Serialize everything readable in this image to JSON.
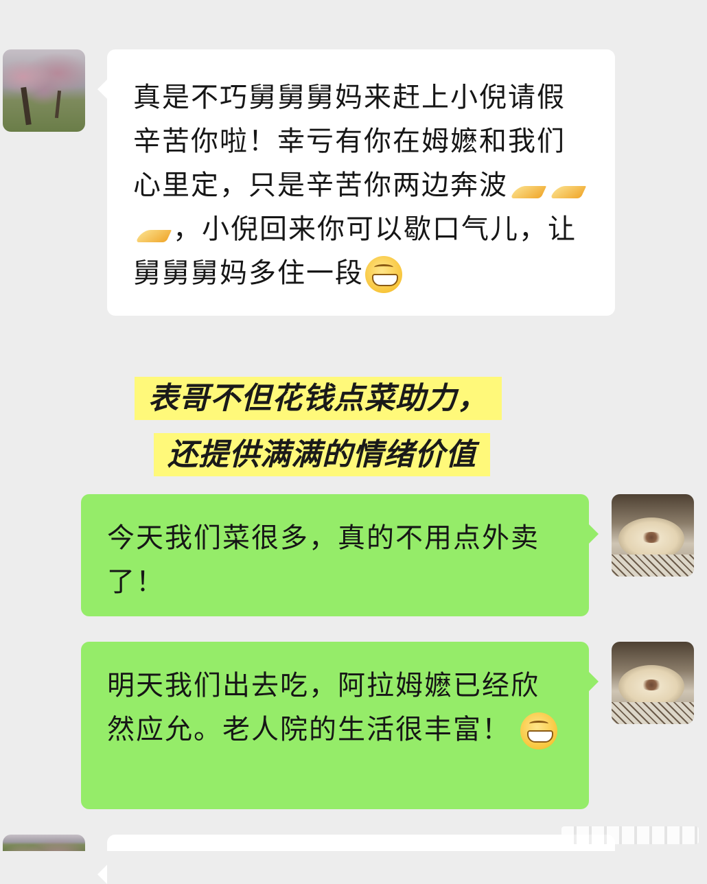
{
  "messages": [
    {
      "side": "left",
      "avatar": "tree-photo-avatar",
      "text_before_emoji_1": "真是不巧舅舅舅妈来赶上小倪请假辛苦你啦！幸亏有你在姆嬷和我们心里定，只是辛苦你两边奔波",
      "emoji_1": "folded-hands-icon",
      "text_after_emoji_1": "，小倪回来你可以歇口气儿，让舅舅舅妈多住一段",
      "emoji_2": "grinning-face-icon"
    },
    {
      "side": "right",
      "avatar": "coffee-cup-avatar",
      "text": "今天我们菜很多，真的不用点外卖了！"
    },
    {
      "side": "right",
      "avatar": "coffee-cup-avatar",
      "text_before_emoji": "明天我们出去吃，阿拉姆嬷已经欣然应允。老人院的生活很丰富！",
      "emoji": "grinning-face-icon"
    }
  ],
  "caption": {
    "line1": "表哥不但花钱点菜助力，",
    "line2": "还提供满满的情绪价值",
    "highlight_color": "#fff97a"
  },
  "colors": {
    "background": "#ededed",
    "incoming_bubble": "#ffffff",
    "outgoing_bubble": "#95ec69"
  }
}
